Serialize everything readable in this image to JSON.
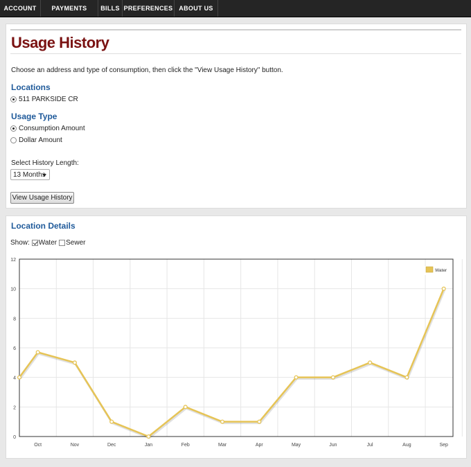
{
  "nav": {
    "items": [
      {
        "label": "ACCOUNT"
      },
      {
        "label": "PAYMENTS"
      },
      {
        "label": "BILLS"
      },
      {
        "label": "PREFERENCES"
      },
      {
        "label": "ABOUT US"
      }
    ]
  },
  "page": {
    "title": "Usage History",
    "intro": "Choose an address and type of consumption, then click the \"View Usage History\" button."
  },
  "locations": {
    "heading": "Locations",
    "options": [
      {
        "label": "511 PARKSIDE CR",
        "selected": true
      }
    ]
  },
  "usage_type": {
    "heading": "Usage Type",
    "options": [
      {
        "label": "Consumption Amount",
        "selected": true
      },
      {
        "label": "Dollar Amount",
        "selected": false
      }
    ]
  },
  "history": {
    "label": "Select History Length:",
    "selected": "13 Months"
  },
  "view_button": "View Usage History",
  "details": {
    "heading": "Location Details",
    "show_label": "Show:",
    "water_label": "Water",
    "water_checked": true,
    "sewer_label": "Sewer",
    "sewer_checked": false
  },
  "chart_data": {
    "type": "line",
    "series": [
      {
        "name": "Water",
        "color": "#e6c456",
        "points": [
          {
            "x": 0.0,
            "y": 4
          },
          {
            "x": 0.5,
            "y": 5.7
          },
          {
            "x": 1.5,
            "y": 5
          },
          {
            "x": 2.5,
            "y": 1
          },
          {
            "x": 3.5,
            "y": 0
          },
          {
            "x": 4.5,
            "y": 2
          },
          {
            "x": 5.5,
            "y": 1
          },
          {
            "x": 6.5,
            "y": 1
          },
          {
            "x": 7.5,
            "y": 4
          },
          {
            "x": 8.5,
            "y": 4
          },
          {
            "x": 9.5,
            "y": 5
          },
          {
            "x": 10.5,
            "y": 4
          },
          {
            "x": 11.5,
            "y": 10
          }
        ]
      }
    ],
    "x_ticks": [
      {
        "label": "Oct",
        "x": 0.5
      },
      {
        "label": "Nov",
        "x": 1.5
      },
      {
        "label": "Dec",
        "x": 2.5
      },
      {
        "label": "Jan",
        "x": 3.5
      },
      {
        "label": "Feb",
        "x": 4.5
      },
      {
        "label": "Mar",
        "x": 5.5
      },
      {
        "label": "Apr",
        "x": 6.5
      },
      {
        "label": "May",
        "x": 7.5
      },
      {
        "label": "Jun",
        "x": 8.5
      },
      {
        "label": "Jul",
        "x": 9.5
      },
      {
        "label": "Aug",
        "x": 10.5
      },
      {
        "label": "Sep",
        "x": 11.5
      }
    ],
    "xlim": [
      0,
      11.75
    ],
    "ylim": [
      0,
      12
    ],
    "y_ticks": [
      0,
      2,
      4,
      6,
      8,
      10,
      12
    ],
    "grid": true,
    "legend": "top-right"
  }
}
